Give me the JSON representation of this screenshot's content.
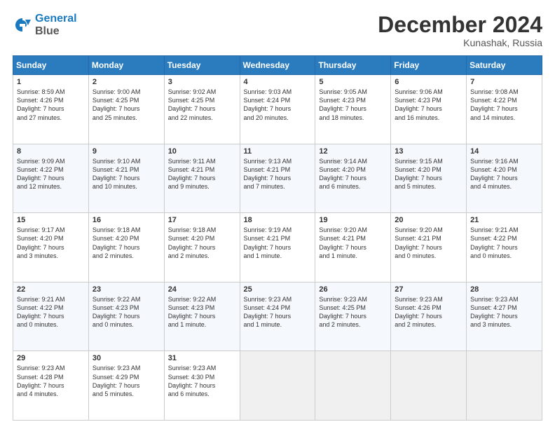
{
  "header": {
    "logo_line1": "General",
    "logo_line2": "Blue",
    "month": "December 2024",
    "location": "Kunashak, Russia"
  },
  "days_of_week": [
    "Sunday",
    "Monday",
    "Tuesday",
    "Wednesday",
    "Thursday",
    "Friday",
    "Saturday"
  ],
  "weeks": [
    [
      {
        "day": "1",
        "lines": [
          "Sunrise: 8:59 AM",
          "Sunset: 4:26 PM",
          "Daylight: 7 hours",
          "and 27 minutes."
        ]
      },
      {
        "day": "2",
        "lines": [
          "Sunrise: 9:00 AM",
          "Sunset: 4:25 PM",
          "Daylight: 7 hours",
          "and 25 minutes."
        ]
      },
      {
        "day": "3",
        "lines": [
          "Sunrise: 9:02 AM",
          "Sunset: 4:25 PM",
          "Daylight: 7 hours",
          "and 22 minutes."
        ]
      },
      {
        "day": "4",
        "lines": [
          "Sunrise: 9:03 AM",
          "Sunset: 4:24 PM",
          "Daylight: 7 hours",
          "and 20 minutes."
        ]
      },
      {
        "day": "5",
        "lines": [
          "Sunrise: 9:05 AM",
          "Sunset: 4:23 PM",
          "Daylight: 7 hours",
          "and 18 minutes."
        ]
      },
      {
        "day": "6",
        "lines": [
          "Sunrise: 9:06 AM",
          "Sunset: 4:23 PM",
          "Daylight: 7 hours",
          "and 16 minutes."
        ]
      },
      {
        "day": "7",
        "lines": [
          "Sunrise: 9:08 AM",
          "Sunset: 4:22 PM",
          "Daylight: 7 hours",
          "and 14 minutes."
        ]
      }
    ],
    [
      {
        "day": "8",
        "lines": [
          "Sunrise: 9:09 AM",
          "Sunset: 4:22 PM",
          "Daylight: 7 hours",
          "and 12 minutes."
        ]
      },
      {
        "day": "9",
        "lines": [
          "Sunrise: 9:10 AM",
          "Sunset: 4:21 PM",
          "Daylight: 7 hours",
          "and 10 minutes."
        ]
      },
      {
        "day": "10",
        "lines": [
          "Sunrise: 9:11 AM",
          "Sunset: 4:21 PM",
          "Daylight: 7 hours",
          "and 9 minutes."
        ]
      },
      {
        "day": "11",
        "lines": [
          "Sunrise: 9:13 AM",
          "Sunset: 4:21 PM",
          "Daylight: 7 hours",
          "and 7 minutes."
        ]
      },
      {
        "day": "12",
        "lines": [
          "Sunrise: 9:14 AM",
          "Sunset: 4:20 PM",
          "Daylight: 7 hours",
          "and 6 minutes."
        ]
      },
      {
        "day": "13",
        "lines": [
          "Sunrise: 9:15 AM",
          "Sunset: 4:20 PM",
          "Daylight: 7 hours",
          "and 5 minutes."
        ]
      },
      {
        "day": "14",
        "lines": [
          "Sunrise: 9:16 AM",
          "Sunset: 4:20 PM",
          "Daylight: 7 hours",
          "and 4 minutes."
        ]
      }
    ],
    [
      {
        "day": "15",
        "lines": [
          "Sunrise: 9:17 AM",
          "Sunset: 4:20 PM",
          "Daylight: 7 hours",
          "and 3 minutes."
        ]
      },
      {
        "day": "16",
        "lines": [
          "Sunrise: 9:18 AM",
          "Sunset: 4:20 PM",
          "Daylight: 7 hours",
          "and 2 minutes."
        ]
      },
      {
        "day": "17",
        "lines": [
          "Sunrise: 9:18 AM",
          "Sunset: 4:20 PM",
          "Daylight: 7 hours",
          "and 2 minutes."
        ]
      },
      {
        "day": "18",
        "lines": [
          "Sunrise: 9:19 AM",
          "Sunset: 4:21 PM",
          "Daylight: 7 hours",
          "and 1 minute."
        ]
      },
      {
        "day": "19",
        "lines": [
          "Sunrise: 9:20 AM",
          "Sunset: 4:21 PM",
          "Daylight: 7 hours",
          "and 1 minute."
        ]
      },
      {
        "day": "20",
        "lines": [
          "Sunrise: 9:20 AM",
          "Sunset: 4:21 PM",
          "Daylight: 7 hours",
          "and 0 minutes."
        ]
      },
      {
        "day": "21",
        "lines": [
          "Sunrise: 9:21 AM",
          "Sunset: 4:22 PM",
          "Daylight: 7 hours",
          "and 0 minutes."
        ]
      }
    ],
    [
      {
        "day": "22",
        "lines": [
          "Sunrise: 9:21 AM",
          "Sunset: 4:22 PM",
          "Daylight: 7 hours",
          "and 0 minutes."
        ]
      },
      {
        "day": "23",
        "lines": [
          "Sunrise: 9:22 AM",
          "Sunset: 4:23 PM",
          "Daylight: 7 hours",
          "and 0 minutes."
        ]
      },
      {
        "day": "24",
        "lines": [
          "Sunrise: 9:22 AM",
          "Sunset: 4:23 PM",
          "Daylight: 7 hours",
          "and 1 minute."
        ]
      },
      {
        "day": "25",
        "lines": [
          "Sunrise: 9:23 AM",
          "Sunset: 4:24 PM",
          "Daylight: 7 hours",
          "and 1 minute."
        ]
      },
      {
        "day": "26",
        "lines": [
          "Sunrise: 9:23 AM",
          "Sunset: 4:25 PM",
          "Daylight: 7 hours",
          "and 2 minutes."
        ]
      },
      {
        "day": "27",
        "lines": [
          "Sunrise: 9:23 AM",
          "Sunset: 4:26 PM",
          "Daylight: 7 hours",
          "and 2 minutes."
        ]
      },
      {
        "day": "28",
        "lines": [
          "Sunrise: 9:23 AM",
          "Sunset: 4:27 PM",
          "Daylight: 7 hours",
          "and 3 minutes."
        ]
      }
    ],
    [
      {
        "day": "29",
        "lines": [
          "Sunrise: 9:23 AM",
          "Sunset: 4:28 PM",
          "Daylight: 7 hours",
          "and 4 minutes."
        ]
      },
      {
        "day": "30",
        "lines": [
          "Sunrise: 9:23 AM",
          "Sunset: 4:29 PM",
          "Daylight: 7 hours",
          "and 5 minutes."
        ]
      },
      {
        "day": "31",
        "lines": [
          "Sunrise: 9:23 AM",
          "Sunset: 4:30 PM",
          "Daylight: 7 hours",
          "and 6 minutes."
        ]
      },
      null,
      null,
      null,
      null
    ]
  ]
}
